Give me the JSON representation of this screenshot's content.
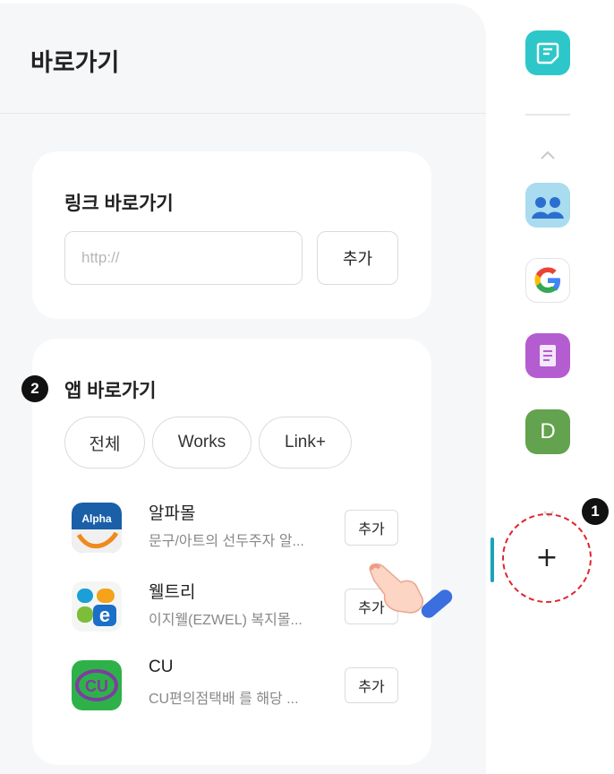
{
  "panel": {
    "title": "바로가기"
  },
  "link_shortcut": {
    "title": "링크 바로가기",
    "url_placeholder": "http://",
    "url_value": "",
    "add_label": "추가"
  },
  "app_shortcut": {
    "step_number": "2",
    "title": "앱 바로가기",
    "tabs": [
      {
        "label": "전체"
      },
      {
        "label": "Works"
      },
      {
        "label": "Link+"
      }
    ],
    "apps": [
      {
        "name": "알파몰",
        "description": "문구/아트의 선두주자 알...",
        "add_label": "추가",
        "icon_text": "Alpha"
      },
      {
        "name": "웰트리",
        "description": "이지웰(EZWEL) 복지몰...",
        "add_label": "추가",
        "icon_text": "e"
      },
      {
        "name": "CU",
        "description": "CU편의점택배 를 해당 ...",
        "add_label": "추가",
        "icon_text": "CU"
      }
    ]
  },
  "rail": {
    "icons": [
      {
        "name": "memo-app-icon",
        "letter": ""
      },
      {
        "name": "people-app-icon",
        "letter": ""
      },
      {
        "name": "google-app-icon",
        "letter": ""
      },
      {
        "name": "document-app-icon",
        "letter": ""
      },
      {
        "name": "d-app-icon",
        "letter": "D"
      }
    ],
    "add_button_label": "+",
    "step_number": "1"
  },
  "colors": {
    "accent_teal": "#1aa3b8",
    "highlight_red": "#e0262b",
    "d_icon_green": "#63a24e",
    "doc_icon_purple": "#b45dd0"
  }
}
